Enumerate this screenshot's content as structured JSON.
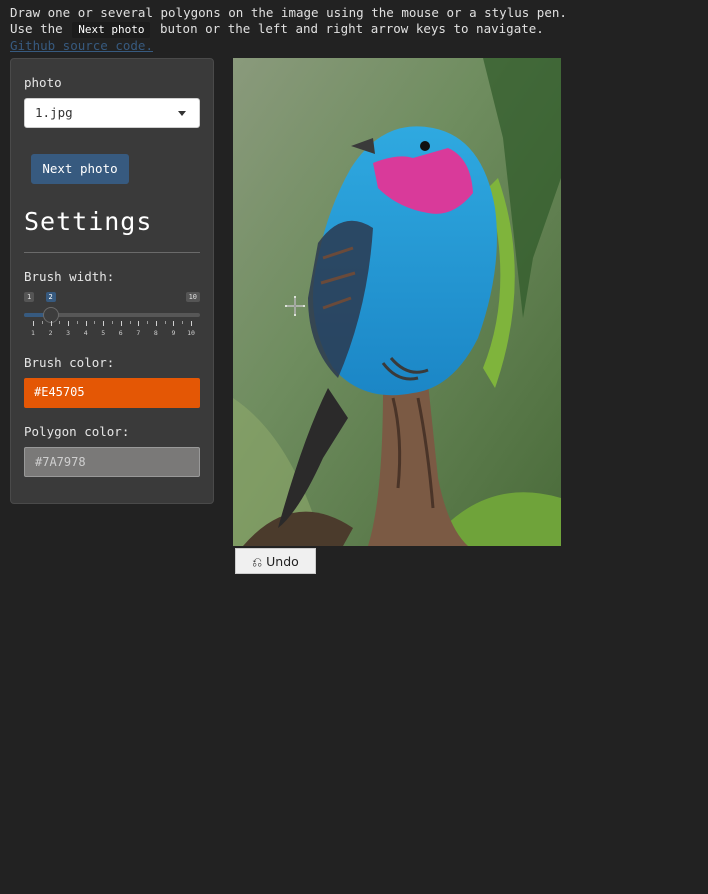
{
  "intro": {
    "line1": "Draw one or several polygons on the image using the mouse or a stylus pen.",
    "line2_before": "Use the",
    "line2_kbd": "Next photo",
    "line2_after": "buton or the left and right arrow keys to navigate.",
    "link": "Github source code."
  },
  "sidebar": {
    "photo_label": "photo",
    "photo_selected": "1.jpg",
    "next_button": "Next photo",
    "settings_title": "Settings",
    "brush_width_label": "Brush width:",
    "brush_width": {
      "min": 1,
      "max": 10,
      "value": 2,
      "min_badge": "1",
      "max_badge": "10",
      "value_badge": "2",
      "ticks": [
        "1",
        "2",
        "3",
        "4",
        "5",
        "6",
        "7",
        "8",
        "9",
        "10"
      ]
    },
    "brush_color_label": "Brush color:",
    "brush_color": "#E45705",
    "polygon_color_label": "Polygon color:",
    "polygon_color": "#7A7978"
  },
  "canvas": {
    "image_name": "1.jpg"
  },
  "undo_label": "⎌ Undo"
}
